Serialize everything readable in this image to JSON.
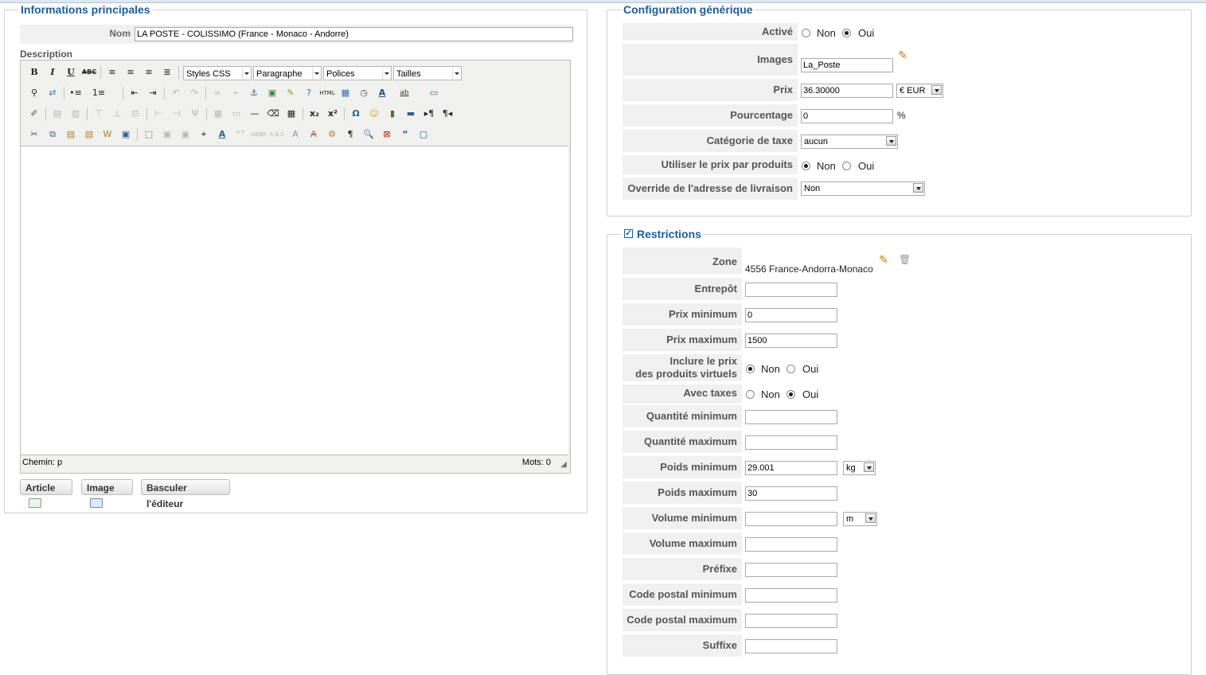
{
  "left": {
    "legend": "Informations principales",
    "nom_label": "Nom",
    "nom_value": "LA POSTE - COLISSIMO (France - Monaco - Andorre)",
    "description_label": "Description",
    "editor": {
      "styles_css": "Styles CSS",
      "paragraphe": "Paragraphe",
      "polices": "Polices",
      "tailles": "Tailles",
      "path": "Chemin: p",
      "words": "Mots: 0",
      "b": "B",
      "i": "I",
      "u": "U",
      "abc": "ABC",
      "omega": "Ω",
      "pilcrow": "¶"
    },
    "buttons": {
      "article": "Article",
      "image": "Image",
      "basculer": "Basculer l'éditeur"
    }
  },
  "config": {
    "legend": "Configuration générique",
    "active_label": "Activé",
    "images_label": "Images",
    "images_value": "La_Poste",
    "prix_label": "Prix",
    "prix_value": "36.30000",
    "currency": "€ EUR",
    "pourcentage_label": "Pourcentage",
    "pourcentage_value": "0",
    "percent_sign": "%",
    "categorie_label": "Catégorie de taxe",
    "categorie_value": "aucun",
    "prix_produits_label": "Utiliser le prix par produits",
    "override_label": "Override de l'adresse de livraison",
    "override_value": "Non",
    "non": "Non",
    "oui": "Oui"
  },
  "restrictions": {
    "legend": "Restrictions",
    "zone_label": "Zone",
    "zone_value": "4556 France-Andorra-Monaco",
    "entrepot_label": "Entrepôt",
    "prix_min_label": "Prix minimum",
    "prix_min_value": "0",
    "prix_max_label": "Prix maximum",
    "prix_max_value": "1500",
    "inclure_label_1": "Inclure le prix",
    "inclure_label_2": "des produits virtuels",
    "avec_taxes_label": "Avec taxes",
    "qte_min_label": "Quantité minimum",
    "qte_max_label": "Quantité maximum",
    "poids_min_label": "Poids minimum",
    "poids_min_value": "29.001",
    "poids_unit": "kg",
    "poids_max_label": "Poids maximum",
    "poids_max_value": "30",
    "vol_min_label": "Volume minimum",
    "vol_unit": "m",
    "vol_max_label": "Volume maximum",
    "prefixe_label": "Préfixe",
    "cp_min_label": "Code postal minimum",
    "cp_max_label": "Code postal maximum",
    "suffixe_label": "Suffixe",
    "non": "Non",
    "oui": "Oui"
  }
}
